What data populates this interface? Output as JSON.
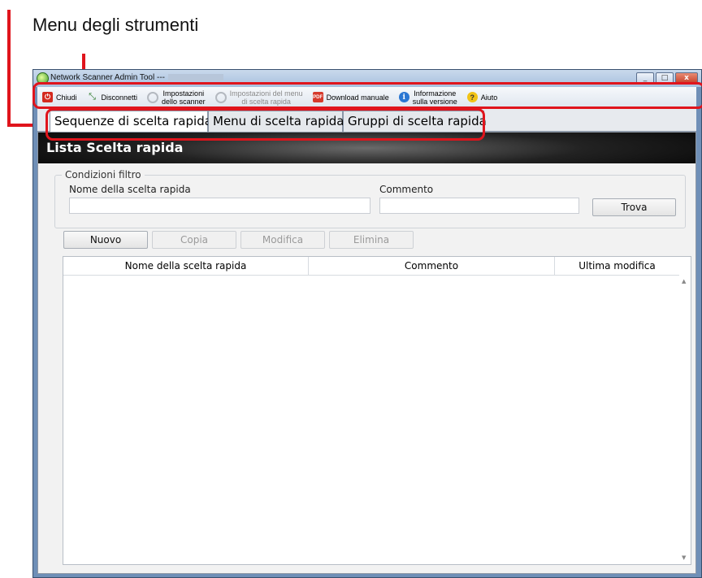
{
  "callout": {
    "label": "Menu degli strumenti"
  },
  "window": {
    "title": "Network Scanner Admin Tool ---",
    "controls": {
      "minimize": "_",
      "maximize": "□",
      "close": "x"
    }
  },
  "toolbar": {
    "items": [
      {
        "label": "Chiudi",
        "icon": "close-power-icon"
      },
      {
        "label": "Disconnetti",
        "icon": "disconnect-icon"
      },
      {
        "label_line1": "Impostazioni",
        "label_line2": "dello scanner",
        "icon": "gear-icon"
      },
      {
        "label_line1": "Impostazioni del menu",
        "label_line2": "di scelta rapida",
        "icon": "gear-icon",
        "disabled": true
      },
      {
        "label": "Download manuale",
        "icon": "pdf-icon"
      },
      {
        "label_line1": "Informazione",
        "label_line2": "sulla versione",
        "icon": "info-icon"
      },
      {
        "label": "Aiuto",
        "icon": "help-icon"
      }
    ]
  },
  "tabs": [
    {
      "label": "Sequenze di scelta rapida",
      "active": true
    },
    {
      "label": "Menu di scelta rapida"
    },
    {
      "label": "Gruppi di scelta rapida"
    }
  ],
  "section": {
    "title": "Lista Scelta rapida"
  },
  "filter": {
    "legend": "Condizioni filtro",
    "name_label": "Nome della scelta rapida",
    "name_value": "",
    "comment_label": "Commento",
    "comment_value": "",
    "find_button": "Trova"
  },
  "actions": {
    "new": "Nuovo",
    "copy": "Copia",
    "edit": "Modifica",
    "delete": "Elimina"
  },
  "table": {
    "columns": [
      "Nome della scelta rapida",
      "Commento",
      "Ultima modifica"
    ],
    "rows": []
  },
  "colors": {
    "highlight": "#e0141c",
    "window_frame": "#6f8fb7",
    "header_bg": "#0a0a0a"
  }
}
